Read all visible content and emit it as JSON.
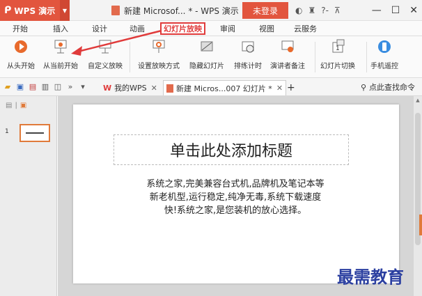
{
  "titlebar": {
    "app_name": "WPS 演示",
    "doc_title": "新建 Microsof... * - WPS 演示",
    "login_label": "未登录",
    "help_label": "?-"
  },
  "menu_tabs": [
    "开始",
    "插入",
    "设计",
    "动画",
    "幻灯片放映",
    "审阅",
    "视图",
    "云服务"
  ],
  "active_tab": "幻灯片放映",
  "ribbon": {
    "items": [
      {
        "label": "从头开始",
        "icon": "play-from-start-icon"
      },
      {
        "label": "从当前开始",
        "icon": "play-from-current-icon"
      },
      {
        "label": "自定义放映",
        "icon": "custom-show-icon"
      },
      {
        "label": "设置放映方式",
        "icon": "setup-show-icon"
      },
      {
        "label": "隐藏幻灯片",
        "icon": "hide-slide-icon"
      },
      {
        "label": "排练计时",
        "icon": "rehearse-timing-icon"
      },
      {
        "label": "演讲者备注",
        "icon": "speaker-notes-icon"
      },
      {
        "label": "幻灯片切换",
        "icon": "slide-transition-icon"
      },
      {
        "label": "手机遥控",
        "icon": "phone-remote-icon"
      }
    ]
  },
  "doc_tabs": {
    "wps_tab": "我的WPS",
    "current_tab": "新建 Micros...007 幻灯片 *",
    "search_label": "点此查找命令"
  },
  "slide_panel": {
    "slide_number": "1"
  },
  "slide": {
    "title_placeholder": "单击此处添加标题",
    "body_lines": [
      "系统之家,完美兼容台式机,品牌机及笔记本等",
      "新老机型,运行稳定,纯净无毒,系统下载速度",
      "快!系统之家,是您装机的放心选择。"
    ]
  },
  "watermark": "最需教育",
  "colors": {
    "accent": "#e2553e",
    "active_tab_border": "#e03b3b",
    "arrow": "#e03b3b",
    "watermark": "#2b3fa0"
  }
}
